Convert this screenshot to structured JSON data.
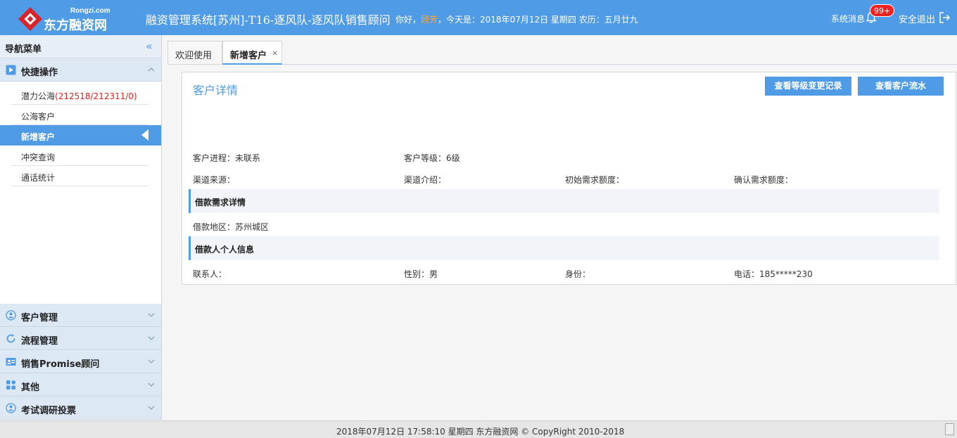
{
  "header": {
    "logo_sub": "Rongzi.com",
    "logo_text": "东方融资网",
    "system_title": "融资管理系统[苏州]-T16-逐风队-逐风队销售顾问",
    "greeting_prefix": "你好，",
    "user_name": "顾芳",
    "greeting_suffix": "，今天是：2018年07月12日 星期四   农历：五月廿九",
    "system_message": "系统消息",
    "badge": "99+",
    "logout": "安全退出"
  },
  "sidebar": {
    "title": "导航菜单",
    "quick_ops": "快捷操作",
    "quick_items": [
      {
        "label": "潜力公海",
        "count": "(212518/212311/0)"
      },
      {
        "label": "公海客户"
      },
      {
        "label": "新增客户"
      },
      {
        "label": "冲突查询"
      },
      {
        "label": "通话统计"
      }
    ],
    "groups": [
      {
        "label": "客户管理"
      },
      {
        "label": "流程管理"
      },
      {
        "label": "销售Promise顾问"
      },
      {
        "label": "其他"
      },
      {
        "label": "考试调研投票"
      }
    ]
  },
  "tabs": [
    {
      "label": "欢迎使用"
    },
    {
      "label": "新增客户",
      "close": "×"
    }
  ],
  "panel": {
    "title": "客户详情",
    "btn_level_log": "查看等级变更记录",
    "btn_flow": "查看客户流水",
    "progress": "客户进程：未联系",
    "level": "客户等级：6级",
    "channel_source": "渠道来源：",
    "channel_intro": "渠道介绍：",
    "initial_amount": "初始需求额度：",
    "confirm_amount": "确认需求额度：",
    "loan_section": "借款需求详情",
    "loan_region": "借款地区：苏州城区",
    "personal_section": "借款人个人信息",
    "contact": "联系人：",
    "gender": "性别：男",
    "identity": "身份：",
    "phone": "电话：185*****230"
  },
  "footer": {
    "text": "2018年07月12日 17:58:10 星期四 东方融资网 © CopyRight 2010-2018"
  },
  "colors": {
    "accent": "#4f9be6",
    "highlight": "#f7a640",
    "danger": "#e02020"
  }
}
